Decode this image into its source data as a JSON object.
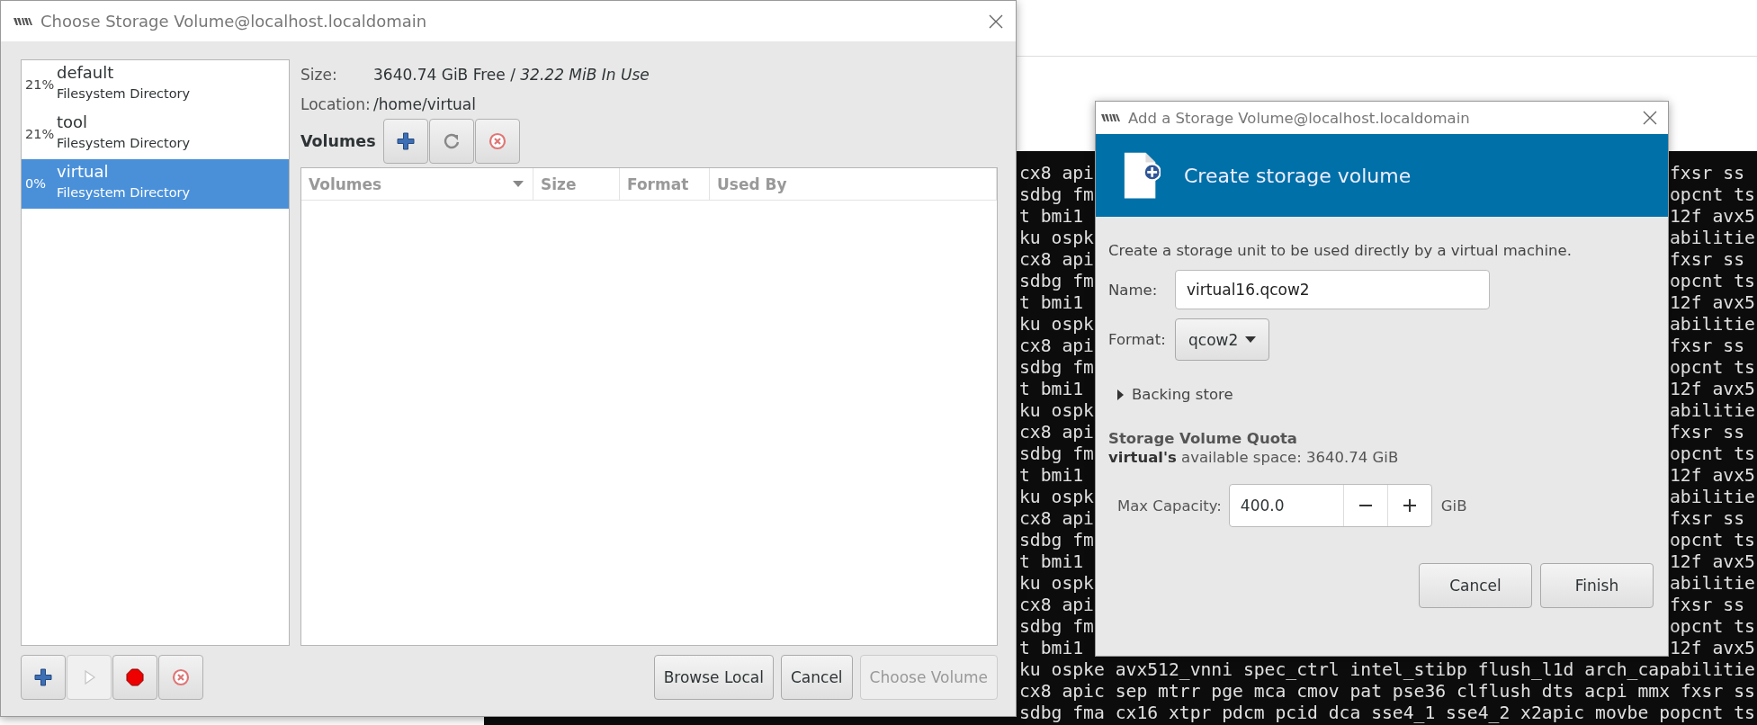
{
  "terminal": {
    "rows": [
      {
        "left": "cx8 api",
        "right": "fxsr ss"
      },
      {
        "left": "sdbg fm",
        "right": "opcnt ts"
      },
      {
        "left": "t bmi1",
        "right": "12f avx5"
      },
      {
        "left": "ku ospk",
        "right": "abilitie"
      },
      {
        "left": "cx8 api",
        "right": "fxsr ss"
      },
      {
        "left": "sdbg fm",
        "right": "opcnt ts"
      },
      {
        "left": "t bmi1",
        "right": "12f avx5"
      },
      {
        "left": "ku ospk",
        "right": "abilitie"
      },
      {
        "left": "cx8 api",
        "right": "fxsr ss"
      },
      {
        "left": "sdbg fm",
        "right": "opcnt ts"
      },
      {
        "left": "t bmi1",
        "right": "12f avx5"
      },
      {
        "left": "ku ospk",
        "right": "abilitie"
      },
      {
        "left": "cx8 api",
        "right": "fxsr ss"
      },
      {
        "left": "sdbg fm",
        "right": "opcnt ts"
      },
      {
        "left": "t bmi1",
        "right": "12f avx5"
      },
      {
        "left": "ku ospk",
        "right": "abilitie"
      },
      {
        "left": "cx8 api",
        "right": "fxsr ss"
      },
      {
        "left": "sdbg fm",
        "right": "opcnt ts"
      },
      {
        "left": "t bmi1",
        "right": "12f avx5"
      },
      {
        "left": "ku ospk",
        "right": "abilitie"
      },
      {
        "left": "cx8 api",
        "right": "fxsr ss"
      },
      {
        "left": "sdbg fm",
        "right": "opcnt ts"
      },
      {
        "left": "t bmi1",
        "right": "12f avx5"
      },
      {
        "text": "ku ospke avx512_vnni spec_ctrl intel_stibp flush_l1d arch_capabilitie"
      },
      {
        "text": "cx8 apic sep mtrr pge mca cmov pat pse36 clflush dts acpi mmx fxsr ss"
      },
      {
        "text": "sdbg fma cx16 xtpr pdcm pcid dca sse4_1 sse4_2 x2apic movbe popcnt ts"
      }
    ]
  },
  "storage_dialog": {
    "title": "Choose Storage Volume@localhost.localdomain",
    "pools": [
      {
        "usage": "21%",
        "name": "default",
        "type": "Filesystem Directory",
        "selected": false
      },
      {
        "usage": "21%",
        "name": "tool",
        "type": "Filesystem Directory",
        "selected": false
      },
      {
        "usage": "0%",
        "name": "virtual",
        "type": "Filesystem Directory",
        "selected": true
      }
    ],
    "size_label": "Size:",
    "size_value": "3640.74 GiB Free / *32.22 MiB In Use*",
    "location_label": "Location:",
    "location_value": "/home/virtual",
    "volumes_label": "Volumes",
    "volume_tools": [
      {
        "kind": "add",
        "disabled": false
      },
      {
        "kind": "refresh",
        "disabled": false
      },
      {
        "kind": "delete",
        "disabled": false
      }
    ],
    "table": {
      "columns": [
        {
          "label": "Volumes",
          "sorted": true
        },
        {
          "label": "Size",
          "sorted": false
        },
        {
          "label": "Format",
          "sorted": false
        },
        {
          "label": "Used By",
          "sorted": false
        }
      ]
    },
    "pool_tools": [
      {
        "kind": "add",
        "disabled": false
      },
      {
        "kind": "start",
        "disabled": true
      },
      {
        "kind": "stop",
        "disabled": false
      },
      {
        "kind": "delete",
        "disabled": false
      }
    ],
    "buttons": [
      {
        "label": "Browse Local",
        "disabled": false
      },
      {
        "label": "Cancel",
        "disabled": false
      },
      {
        "label": "Choose Volume",
        "disabled": true
      }
    ]
  },
  "add_dialog": {
    "title": "Add a Storage Volume@localhost.localdomain",
    "header": "Create storage volume",
    "description": "Create a storage unit to be used directly by a virtual machine.",
    "name_label": "Name:",
    "name_value": "virtual16.qcow2",
    "format_label": "Format:",
    "format_value": "qcow2",
    "backing_store": {
      "label": "Backing store",
      "expanded": false
    },
    "quota_title": "Storage Volume Quota",
    "quota_text": "**virtual's** available space: 3640.74 GiB",
    "capacity_label": "Max Capacity:",
    "capacity_value": "400.0",
    "capacity_unit": "GiB",
    "buttons": [
      {
        "label": "Cancel"
      },
      {
        "label": "Finish"
      }
    ]
  }
}
